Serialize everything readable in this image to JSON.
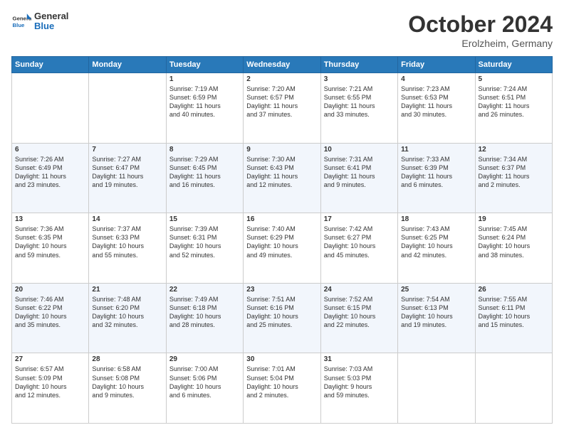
{
  "header": {
    "logo_general": "General",
    "logo_blue": "Blue",
    "month_title": "October 2024",
    "location": "Erolzheim, Germany"
  },
  "weekdays": [
    "Sunday",
    "Monday",
    "Tuesday",
    "Wednesday",
    "Thursday",
    "Friday",
    "Saturday"
  ],
  "rows": [
    [
      {
        "day": "",
        "lines": []
      },
      {
        "day": "",
        "lines": []
      },
      {
        "day": "1",
        "lines": [
          "Sunrise: 7:19 AM",
          "Sunset: 6:59 PM",
          "Daylight: 11 hours",
          "and 40 minutes."
        ]
      },
      {
        "day": "2",
        "lines": [
          "Sunrise: 7:20 AM",
          "Sunset: 6:57 PM",
          "Daylight: 11 hours",
          "and 37 minutes."
        ]
      },
      {
        "day": "3",
        "lines": [
          "Sunrise: 7:21 AM",
          "Sunset: 6:55 PM",
          "Daylight: 11 hours",
          "and 33 minutes."
        ]
      },
      {
        "day": "4",
        "lines": [
          "Sunrise: 7:23 AM",
          "Sunset: 6:53 PM",
          "Daylight: 11 hours",
          "and 30 minutes."
        ]
      },
      {
        "day": "5",
        "lines": [
          "Sunrise: 7:24 AM",
          "Sunset: 6:51 PM",
          "Daylight: 11 hours",
          "and 26 minutes."
        ]
      }
    ],
    [
      {
        "day": "6",
        "lines": [
          "Sunrise: 7:26 AM",
          "Sunset: 6:49 PM",
          "Daylight: 11 hours",
          "and 23 minutes."
        ]
      },
      {
        "day": "7",
        "lines": [
          "Sunrise: 7:27 AM",
          "Sunset: 6:47 PM",
          "Daylight: 11 hours",
          "and 19 minutes."
        ]
      },
      {
        "day": "8",
        "lines": [
          "Sunrise: 7:29 AM",
          "Sunset: 6:45 PM",
          "Daylight: 11 hours",
          "and 16 minutes."
        ]
      },
      {
        "day": "9",
        "lines": [
          "Sunrise: 7:30 AM",
          "Sunset: 6:43 PM",
          "Daylight: 11 hours",
          "and 12 minutes."
        ]
      },
      {
        "day": "10",
        "lines": [
          "Sunrise: 7:31 AM",
          "Sunset: 6:41 PM",
          "Daylight: 11 hours",
          "and 9 minutes."
        ]
      },
      {
        "day": "11",
        "lines": [
          "Sunrise: 7:33 AM",
          "Sunset: 6:39 PM",
          "Daylight: 11 hours",
          "and 6 minutes."
        ]
      },
      {
        "day": "12",
        "lines": [
          "Sunrise: 7:34 AM",
          "Sunset: 6:37 PM",
          "Daylight: 11 hours",
          "and 2 minutes."
        ]
      }
    ],
    [
      {
        "day": "13",
        "lines": [
          "Sunrise: 7:36 AM",
          "Sunset: 6:35 PM",
          "Daylight: 10 hours",
          "and 59 minutes."
        ]
      },
      {
        "day": "14",
        "lines": [
          "Sunrise: 7:37 AM",
          "Sunset: 6:33 PM",
          "Daylight: 10 hours",
          "and 55 minutes."
        ]
      },
      {
        "day": "15",
        "lines": [
          "Sunrise: 7:39 AM",
          "Sunset: 6:31 PM",
          "Daylight: 10 hours",
          "and 52 minutes."
        ]
      },
      {
        "day": "16",
        "lines": [
          "Sunrise: 7:40 AM",
          "Sunset: 6:29 PM",
          "Daylight: 10 hours",
          "and 49 minutes."
        ]
      },
      {
        "day": "17",
        "lines": [
          "Sunrise: 7:42 AM",
          "Sunset: 6:27 PM",
          "Daylight: 10 hours",
          "and 45 minutes."
        ]
      },
      {
        "day": "18",
        "lines": [
          "Sunrise: 7:43 AM",
          "Sunset: 6:25 PM",
          "Daylight: 10 hours",
          "and 42 minutes."
        ]
      },
      {
        "day": "19",
        "lines": [
          "Sunrise: 7:45 AM",
          "Sunset: 6:24 PM",
          "Daylight: 10 hours",
          "and 38 minutes."
        ]
      }
    ],
    [
      {
        "day": "20",
        "lines": [
          "Sunrise: 7:46 AM",
          "Sunset: 6:22 PM",
          "Daylight: 10 hours",
          "and 35 minutes."
        ]
      },
      {
        "day": "21",
        "lines": [
          "Sunrise: 7:48 AM",
          "Sunset: 6:20 PM",
          "Daylight: 10 hours",
          "and 32 minutes."
        ]
      },
      {
        "day": "22",
        "lines": [
          "Sunrise: 7:49 AM",
          "Sunset: 6:18 PM",
          "Daylight: 10 hours",
          "and 28 minutes."
        ]
      },
      {
        "day": "23",
        "lines": [
          "Sunrise: 7:51 AM",
          "Sunset: 6:16 PM",
          "Daylight: 10 hours",
          "and 25 minutes."
        ]
      },
      {
        "day": "24",
        "lines": [
          "Sunrise: 7:52 AM",
          "Sunset: 6:15 PM",
          "Daylight: 10 hours",
          "and 22 minutes."
        ]
      },
      {
        "day": "25",
        "lines": [
          "Sunrise: 7:54 AM",
          "Sunset: 6:13 PM",
          "Daylight: 10 hours",
          "and 19 minutes."
        ]
      },
      {
        "day": "26",
        "lines": [
          "Sunrise: 7:55 AM",
          "Sunset: 6:11 PM",
          "Daylight: 10 hours",
          "and 15 minutes."
        ]
      }
    ],
    [
      {
        "day": "27",
        "lines": [
          "Sunrise: 6:57 AM",
          "Sunset: 5:09 PM",
          "Daylight: 10 hours",
          "and 12 minutes."
        ]
      },
      {
        "day": "28",
        "lines": [
          "Sunrise: 6:58 AM",
          "Sunset: 5:08 PM",
          "Daylight: 10 hours",
          "and 9 minutes."
        ]
      },
      {
        "day": "29",
        "lines": [
          "Sunrise: 7:00 AM",
          "Sunset: 5:06 PM",
          "Daylight: 10 hours",
          "and 6 minutes."
        ]
      },
      {
        "day": "30",
        "lines": [
          "Sunrise: 7:01 AM",
          "Sunset: 5:04 PM",
          "Daylight: 10 hours",
          "and 2 minutes."
        ]
      },
      {
        "day": "31",
        "lines": [
          "Sunrise: 7:03 AM",
          "Sunset: 5:03 PM",
          "Daylight: 9 hours",
          "and 59 minutes."
        ]
      },
      {
        "day": "",
        "lines": []
      },
      {
        "day": "",
        "lines": []
      }
    ]
  ]
}
